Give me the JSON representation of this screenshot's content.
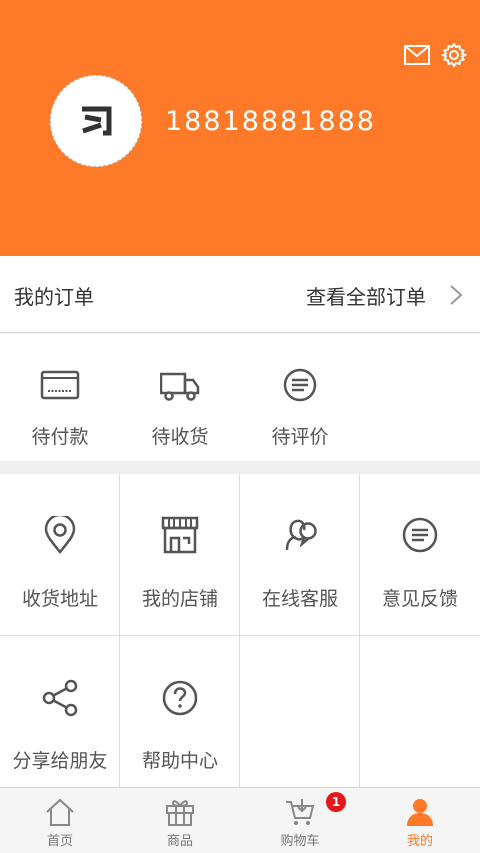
{
  "header": {
    "username": "18818881888",
    "avatar_glyph": "习",
    "icons": [
      "mail-icon",
      "gear-icon"
    ],
    "background_color": "#fe7a28"
  },
  "orders": {
    "title": "我的订单",
    "view_all": "查看全部订单"
  },
  "order_status": [
    {
      "label": "待付款",
      "icon": "wallet-icon"
    },
    {
      "label": "待收货",
      "icon": "truck-icon"
    },
    {
      "label": "待评价",
      "icon": "comment-icon"
    }
  ],
  "services": [
    {
      "label": "收货地址",
      "icon": "location-pin-icon"
    },
    {
      "label": "我的店铺",
      "icon": "store-icon"
    },
    {
      "label": "在线客服",
      "icon": "customer-service-icon"
    },
    {
      "label": "意见反馈",
      "icon": "feedback-icon"
    },
    {
      "label": "分享给朋友",
      "icon": "share-icon"
    },
    {
      "label": "帮助中心",
      "icon": "help-icon"
    }
  ],
  "tabbar": {
    "items": [
      {
        "label": "首页",
        "icon": "home-icon"
      },
      {
        "label": "商品",
        "icon": "gift-icon"
      },
      {
        "label": "购物车",
        "icon": "cart-icon"
      },
      {
        "label": "我的",
        "icon": "user-icon"
      }
    ],
    "active": "我的",
    "cart_badge": "1",
    "accent_color": "#fe7a28",
    "badge_color": "#e8151c"
  }
}
